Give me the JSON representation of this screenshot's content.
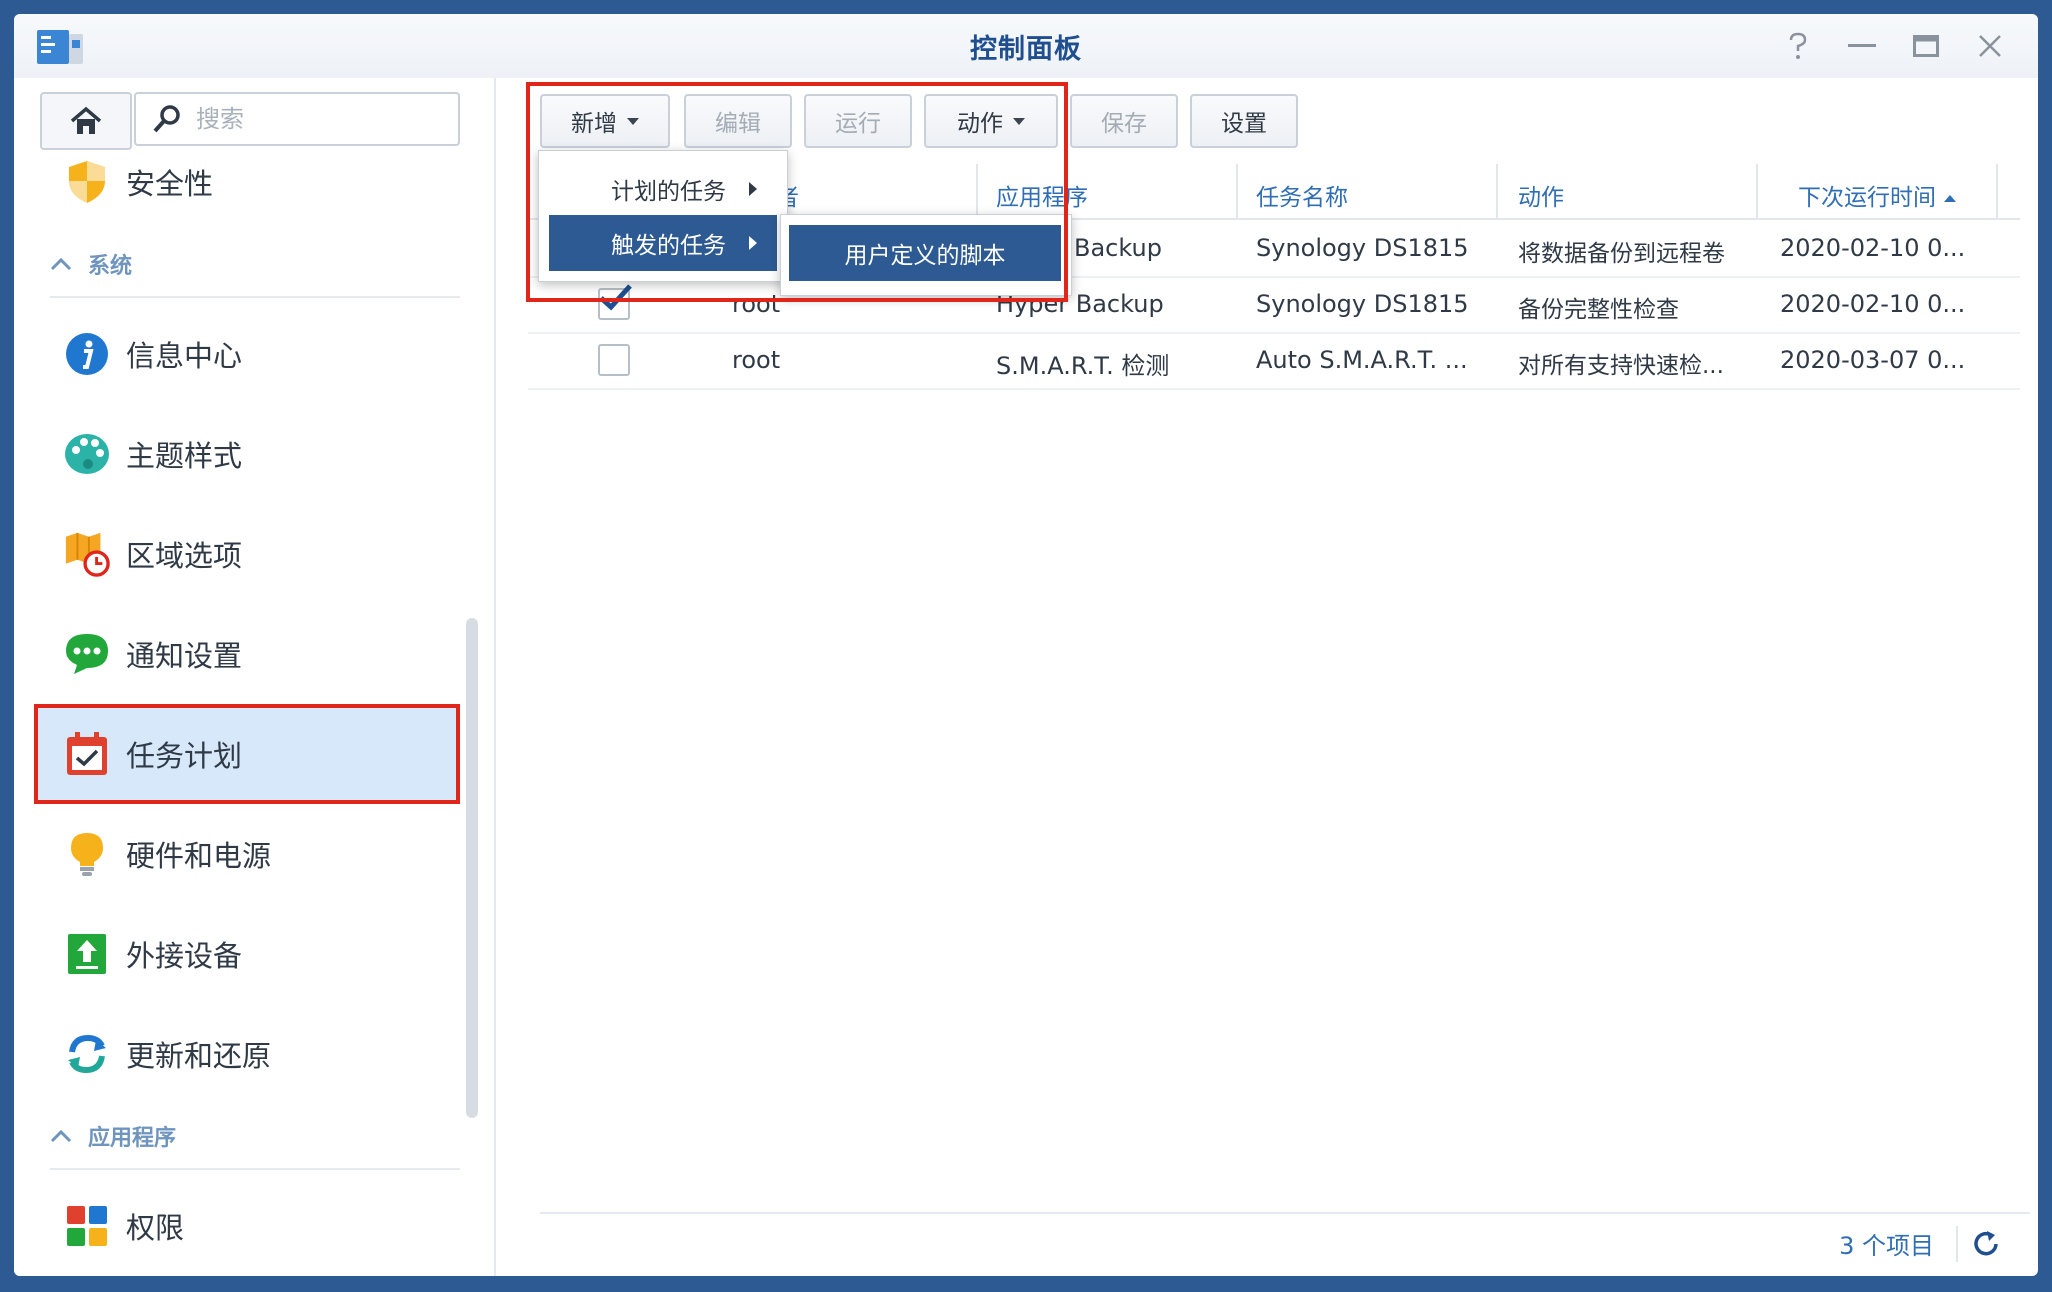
{
  "window": {
    "title": "控制面板",
    "controls": [
      "help-icon",
      "minimize-icon",
      "maximize-icon",
      "close-icon"
    ]
  },
  "sidebar": {
    "search_placeholder": "搜索",
    "items_top": [
      {
        "label": "安全性",
        "icon": "shield-icon"
      }
    ],
    "section_system": "系统",
    "items": [
      {
        "label": "信息中心",
        "icon": "info-icon"
      },
      {
        "label": "主题样式",
        "icon": "palette-icon"
      },
      {
        "label": "区域选项",
        "icon": "region-icon"
      },
      {
        "label": "通知设置",
        "icon": "chat-icon"
      },
      {
        "label": "任务计划",
        "icon": "calendar-check-icon",
        "active": true
      },
      {
        "label": "硬件和电源",
        "icon": "bulb-icon"
      },
      {
        "label": "外接设备",
        "icon": "upload-device-icon"
      },
      {
        "label": "更新和还原",
        "icon": "refresh-icon"
      }
    ],
    "section_apps": "应用程序",
    "app_items": [
      {
        "label": "权限",
        "icon": "permissions-icon"
      }
    ]
  },
  "toolbar": {
    "new_label": "新增",
    "edit_label": "编辑",
    "run_label": "运行",
    "action_label": "动作",
    "save_label": "保存",
    "settings_label": "设置"
  },
  "menu": {
    "scheduled_task": "计划的任务",
    "triggered_task": "触发的任务",
    "user_script": "用户定义的脚本"
  },
  "table": {
    "columns": [
      "者",
      "应用程序",
      "任务名称",
      "动作",
      "下次运行时间"
    ],
    "rows": [
      {
        "checked": false,
        "owner": "",
        "app": "Backup",
        "name": "Synology DS1815",
        "action": "将数据备份到远程卷",
        "next": "2020-02-10 0..."
      },
      {
        "checked": true,
        "owner": "root",
        "app": "Hyper Backup",
        "name": "Synology DS1815",
        "action": "备份完整性检查",
        "next": "2020-02-10 0..."
      },
      {
        "checked": false,
        "owner": "root",
        "app": "S.M.A.R.T. 检测",
        "name": "Auto S.M.A.R.T. ...",
        "action": "对所有支持快速检...",
        "next": "2020-03-07 0..."
      }
    ]
  },
  "footer": {
    "count": "3 个项目"
  },
  "colors": {
    "accent": "#2d5a93",
    "highlight": "#e0251b",
    "selected_bg": "#d7e8fa",
    "header_text": "#2f6eb5"
  }
}
